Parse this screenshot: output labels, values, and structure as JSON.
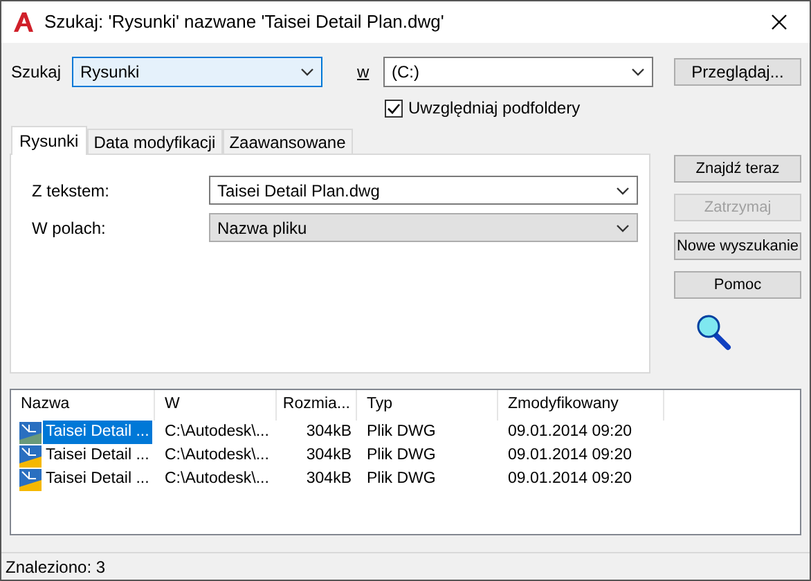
{
  "window": {
    "title": "Szukaj: 'Rysunki' nazwane 'Taisei Detail Plan.dwg'"
  },
  "search": {
    "label": "Szukaj",
    "value": "Rysunki",
    "in_label": "w",
    "in_value": "(C:)",
    "browse": "Przeglądaj...",
    "subfolders": {
      "label": "Uwzględniaj podfoldery",
      "checked": true
    }
  },
  "tabs": [
    {
      "label": "Rysunki",
      "selected": true
    },
    {
      "label": "Data modyfikacji",
      "selected": false
    },
    {
      "label": "Zaawansowane",
      "selected": false
    }
  ],
  "fields": [
    {
      "label": "Z tekstem:",
      "value": "Taisei Detail Plan.dwg",
      "editable": true
    },
    {
      "label": "W polach:",
      "value": "Nazwa pliku",
      "editable": false
    }
  ],
  "buttons": [
    {
      "label": "Znajdź teraz",
      "disabled": false
    },
    {
      "label": "Zatrzymaj",
      "disabled": true
    },
    {
      "label": "Nowe wyszukanie",
      "disabled": false
    },
    {
      "label": "Pomoc",
      "disabled": false
    }
  ],
  "table": {
    "columns": [
      "Nazwa",
      "W",
      "Rozmia...",
      "Typ",
      "Zmodyfikowany"
    ],
    "rows": [
      {
        "cells": [
          "Taisei Detail ...",
          "C:\\Autodesk\\...",
          "304kB",
          "Plik DWG",
          "09.01.2014 09:20"
        ],
        "selected": true
      },
      {
        "cells": [
          "Taisei Detail ...",
          "C:\\Autodesk\\...",
          "304kB",
          "Plik DWG",
          "09.01.2014 09:20"
        ],
        "selected": false
      },
      {
        "cells": [
          "Taisei Detail ...",
          "C:\\Autodesk\\...",
          "304kB",
          "Plik DWG",
          "09.01.2014 09:20"
        ],
        "selected": false
      }
    ]
  },
  "status_bar": "Znaleziono: 3"
}
